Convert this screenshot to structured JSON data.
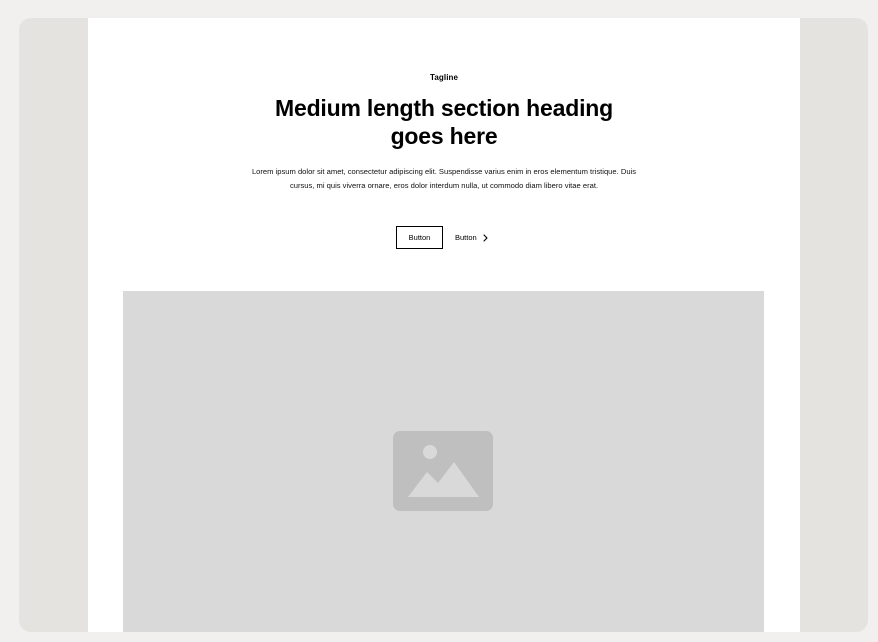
{
  "hero": {
    "tagline": "Tagline",
    "heading": "Medium length section heading goes here",
    "body": "Lorem ipsum dolor sit amet, consectetur adipiscing elit. Suspendisse varius enim in eros elementum tristique. Duis cursus, mi quis viverra ornare, eros dolor interdum nulla, ut commodo diam libero vitae erat.",
    "primary_button_label": "Button",
    "secondary_button_label": "Button",
    "secondary_button_icon": "chevron-right-icon"
  },
  "media": {
    "placeholder_icon": "image-icon"
  },
  "colors": {
    "canvas": "#f1f0ee",
    "stage": "#e4e3df",
    "page": "#ffffff",
    "placeholder": "#d9d9d9",
    "placeholder_icon": "#bfbfbf",
    "text": "#000000"
  }
}
